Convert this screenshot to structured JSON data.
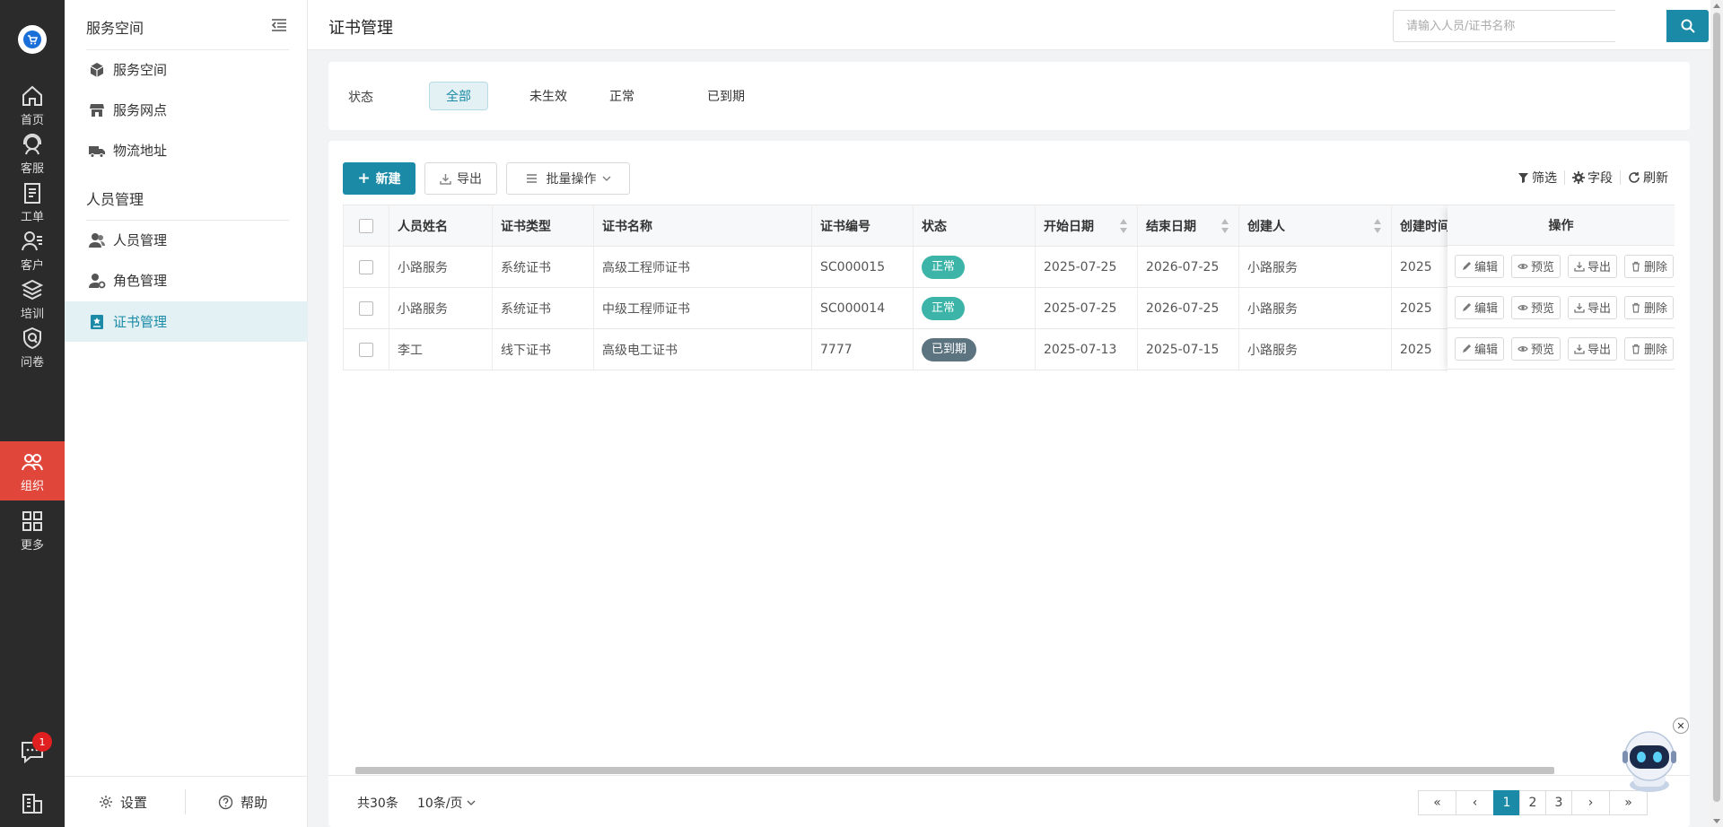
{
  "rail": {
    "items": [
      {
        "label": "首页",
        "icon": "home-icon"
      },
      {
        "label": "客服",
        "icon": "headset-icon"
      },
      {
        "label": "工单",
        "icon": "clipboard-icon"
      },
      {
        "label": "客户",
        "icon": "customer-icon"
      },
      {
        "label": "培训",
        "icon": "layers-icon"
      },
      {
        "label": "问卷",
        "icon": "shield-q-icon"
      },
      {
        "label": "组织",
        "icon": "group-icon"
      },
      {
        "label": "更多",
        "icon": "grid-icon"
      }
    ],
    "active": "组织",
    "notification_count": "1",
    "accent": "#e0463a"
  },
  "sidebar": {
    "section1": "服务空间",
    "items1": [
      {
        "label": "服务空间",
        "icon": "cube-icon"
      },
      {
        "label": "服务网点",
        "icon": "store-icon"
      },
      {
        "label": "物流地址",
        "icon": "truck-icon"
      }
    ],
    "section2": "人员管理",
    "items2": [
      {
        "label": "人员管理",
        "icon": "users-icon"
      },
      {
        "label": "角色管理",
        "icon": "user-cog-icon"
      },
      {
        "label": "证书管理",
        "icon": "certificate-icon"
      }
    ],
    "footer": {
      "settings": "设置",
      "help": "帮助"
    }
  },
  "header": {
    "title": "证书管理",
    "search_placeholder": "请输入人员/证书名称"
  },
  "filter": {
    "label": "状态",
    "options": [
      "全部",
      "未生效",
      "正常",
      "已到期"
    ],
    "selected": "全部"
  },
  "toolbar": {
    "new": "新建",
    "export": "导出",
    "batch": "批量操作",
    "filter": "筛选",
    "fields": "字段",
    "refresh": "刷新"
  },
  "table": {
    "columns": [
      "人员姓名",
      "证书类型",
      "证书名称",
      "证书编号",
      "状态",
      "开始日期",
      "结束日期",
      "创建人",
      "创建时间"
    ],
    "ops_header": "操作",
    "rows": [
      {
        "name": "小路服务",
        "type": "系统证书",
        "cert": "高级工程师证书",
        "code": "SC000015",
        "status": "正常",
        "start": "2025-07-25",
        "end": "2026-07-25",
        "creator": "小路服务",
        "created": "2025"
      },
      {
        "name": "小路服务",
        "type": "系统证书",
        "cert": "中级工程师证书",
        "code": "SC000014",
        "status": "正常",
        "start": "2025-07-25",
        "end": "2026-07-25",
        "creator": "小路服务",
        "created": "2025"
      },
      {
        "name": "李工",
        "type": "线下证书",
        "cert": "高级电工证书",
        "code": "7777",
        "status": "已到期",
        "start": "2025-07-13",
        "end": "2025-07-15",
        "creator": "小路服务",
        "created": "2025"
      }
    ],
    "ops": [
      "编辑",
      "预览",
      "导出",
      "删除"
    ],
    "status_colors": {
      "正常": "#3cb4a8",
      "已到期": "#5c7380"
    }
  },
  "footer": {
    "total": "共30条",
    "page_size": "10条/页",
    "pages": [
      "1",
      "2",
      "3"
    ],
    "current_page": "1"
  },
  "colors": {
    "primary": "#1a8aa6",
    "rail_bg": "#2b2b2b"
  }
}
